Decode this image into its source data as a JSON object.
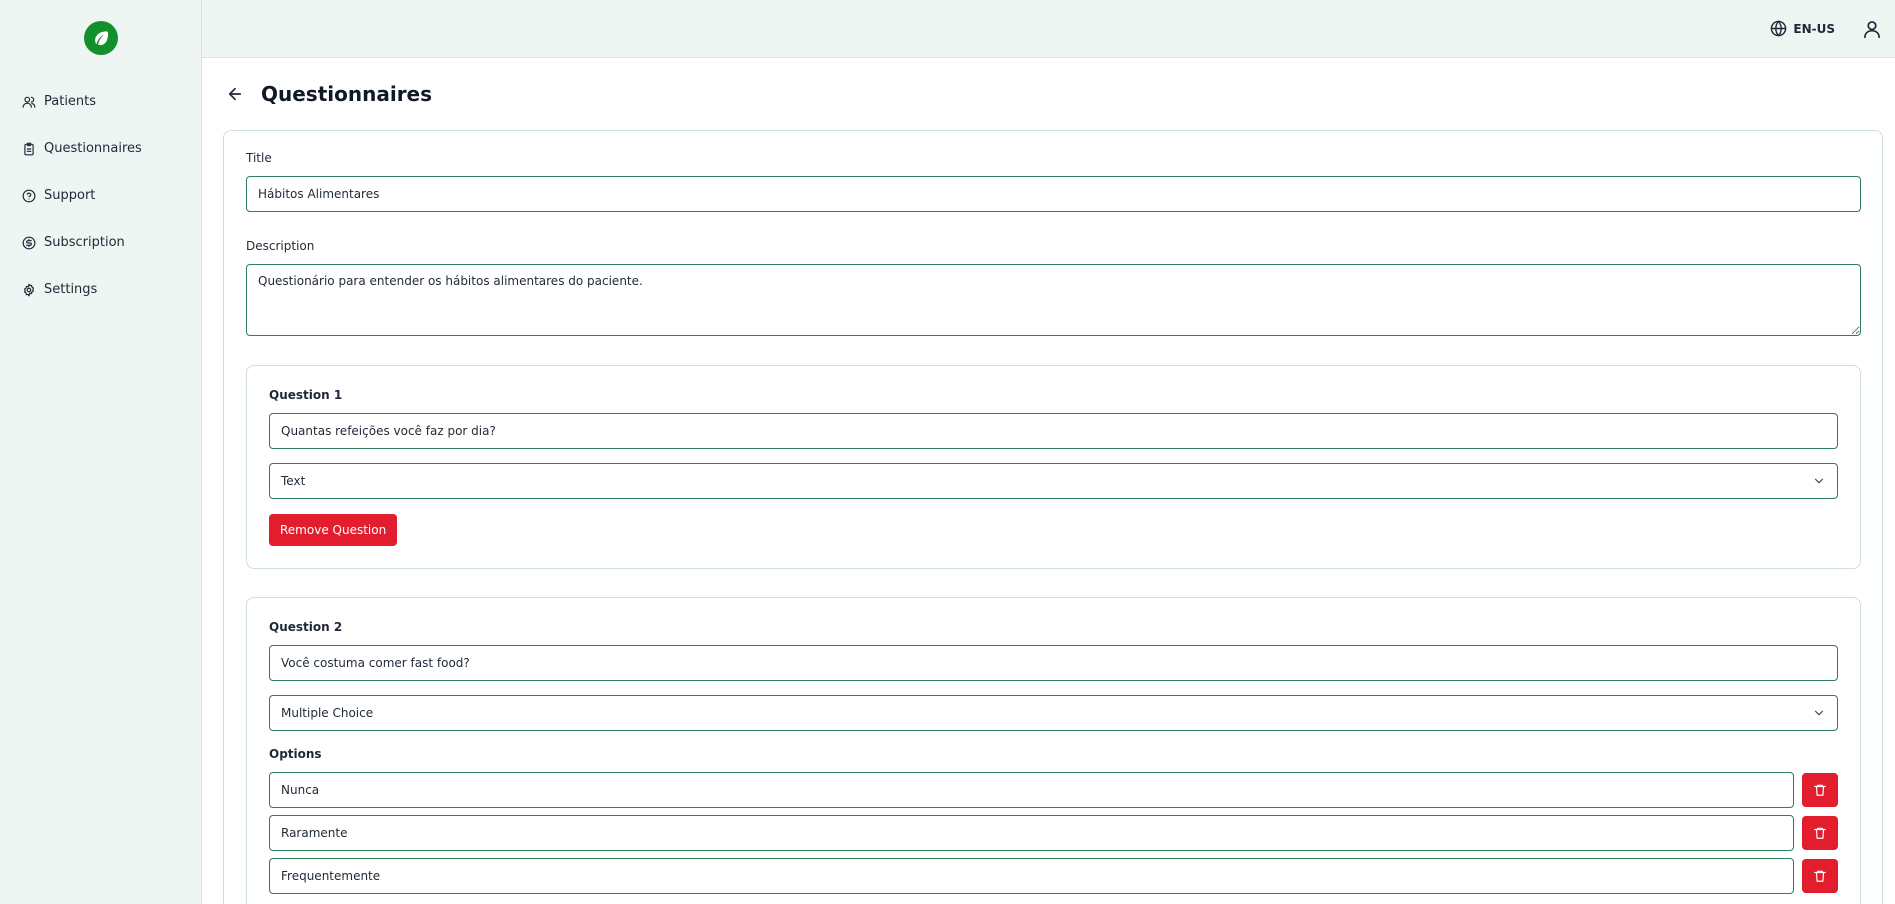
{
  "brand": {
    "color": "#12902b",
    "logo_icon": "leaf-icon"
  },
  "sidebar": {
    "items": [
      {
        "label": "Patients",
        "icon": "users-icon"
      },
      {
        "label": "Questionnaires",
        "icon": "clipboard-icon"
      },
      {
        "label": "Support",
        "icon": "help-circle-icon"
      },
      {
        "label": "Subscription",
        "icon": "dollar-circle-icon"
      },
      {
        "label": "Settings",
        "icon": "gear-icon"
      }
    ]
  },
  "topbar": {
    "language": "EN-US",
    "language_icon": "globe-icon",
    "user_icon": "user-icon"
  },
  "page": {
    "title": "Questionnaires",
    "back_icon": "arrow-left-icon"
  },
  "form": {
    "title_label": "Title",
    "title_value": "Hábitos Alimentares",
    "description_label": "Description",
    "description_value": "Questionário para entender os hábitos alimentares do paciente.",
    "questions": [
      {
        "label": "Question 1",
        "text": "Quantas refeições você faz por dia?",
        "type": "Text",
        "remove_label": "Remove Question"
      },
      {
        "label": "Question 2",
        "text": "Você costuma comer fast food?",
        "type": "Multiple Choice",
        "options_label": "Options",
        "options": [
          "Nunca",
          "Raramente",
          "Frequentemente"
        ]
      }
    ]
  },
  "colors": {
    "danger": "#e11d2e",
    "input_border": "#2e7d5b",
    "sidebar_bg": "#eef5f2"
  }
}
